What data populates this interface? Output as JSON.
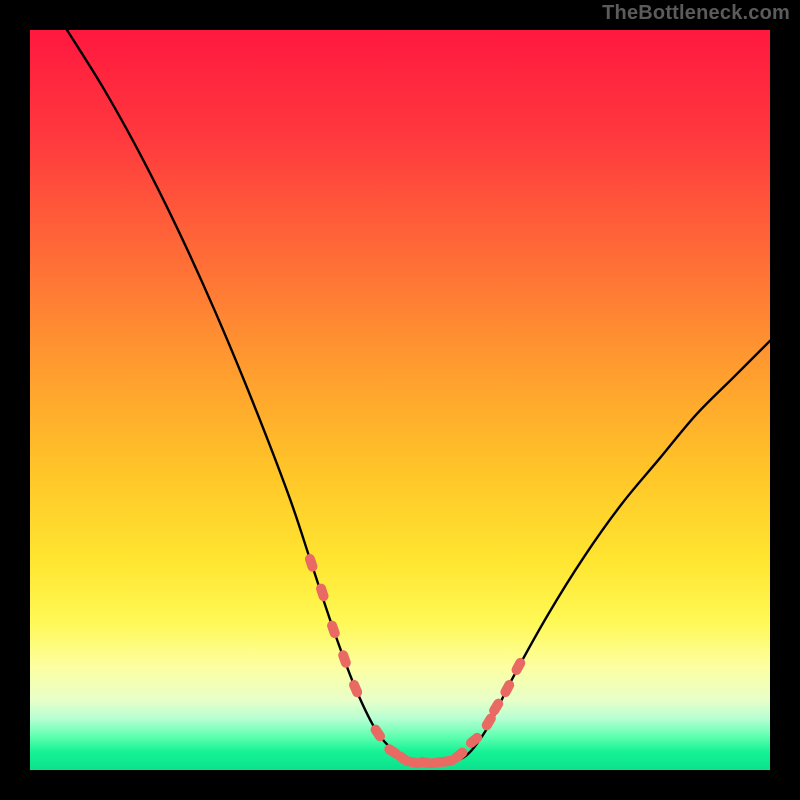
{
  "watermark": "TheBottleneck.com",
  "colors": {
    "background": "#000000",
    "gradient_stops": [
      {
        "offset": 0.0,
        "color": "#ff183f"
      },
      {
        "offset": 0.15,
        "color": "#ff3a3e"
      },
      {
        "offset": 0.3,
        "color": "#ff6a37"
      },
      {
        "offset": 0.45,
        "color": "#ff9a2f"
      },
      {
        "offset": 0.6,
        "color": "#ffc628"
      },
      {
        "offset": 0.72,
        "color": "#ffe631"
      },
      {
        "offset": 0.8,
        "color": "#fff956"
      },
      {
        "offset": 0.86,
        "color": "#fdffa0"
      },
      {
        "offset": 0.905,
        "color": "#e8ffc8"
      },
      {
        "offset": 0.93,
        "color": "#b8ffd2"
      },
      {
        "offset": 0.955,
        "color": "#5effb0"
      },
      {
        "offset": 0.975,
        "color": "#17f296"
      },
      {
        "offset": 1.0,
        "color": "#0ae28c"
      }
    ],
    "curve": "#000000",
    "markers": "#e86a63"
  },
  "chart_data": {
    "type": "line",
    "title": "",
    "xlabel": "",
    "ylabel": "",
    "xlim": [
      0,
      100
    ],
    "ylim": [
      0,
      100
    ],
    "series": [
      {
        "name": "bottleneck-curve",
        "x": [
          5,
          10,
          15,
          20,
          25,
          30,
          35,
          38,
          41,
          44,
          47,
          50,
          53,
          56,
          59,
          62,
          65,
          70,
          75,
          80,
          85,
          90,
          95,
          100
        ],
        "y": [
          100,
          92,
          83,
          73,
          62,
          50,
          37,
          28,
          19,
          11,
          5,
          2,
          1,
          1,
          2,
          6,
          12,
          21,
          29,
          36,
          42,
          48,
          53,
          58
        ]
      }
    ],
    "markers": {
      "name": "highlight-points",
      "x": [
        38,
        39.5,
        41,
        42.5,
        44,
        47,
        49,
        50.5,
        52,
        53.5,
        55,
        56.5,
        58,
        60,
        62,
        63,
        64.5,
        66
      ],
      "y": [
        28,
        24,
        19,
        15,
        11,
        5,
        2.5,
        1.5,
        1,
        1,
        1,
        1.2,
        2,
        4,
        6.5,
        8.5,
        11,
        14
      ]
    }
  }
}
